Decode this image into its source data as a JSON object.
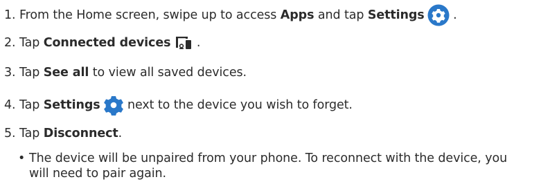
{
  "steps": [
    {
      "num": "1.",
      "pre": "From the Home screen, swipe up to access ",
      "bold1": "Apps",
      "mid": " and tap ",
      "bold2": "Settings",
      "post": " .",
      "icon": "settings-gear-circle-icon"
    },
    {
      "num": "2.",
      "pre": "Tap ",
      "bold": "Connected devices",
      "post": " .",
      "icon": "connected-devices-icon"
    },
    {
      "num": "3.",
      "pre": "Tap ",
      "bold": "See all",
      "post": " to view all saved devices."
    },
    {
      "num": "4.",
      "pre": "Tap ",
      "bold": "Settings",
      "post": " next to the device you wish to forget.",
      "icon": "settings-gear-icon"
    },
    {
      "num": "5.",
      "pre": "Tap ",
      "bold": "Disconnect",
      "post": "."
    }
  ],
  "bullet": {
    "marker": "•",
    "text": "The device will be unpaired from your phone. To reconnect with the device, you will need to pair again."
  },
  "colors": {
    "text": "#2b2b2b",
    "icon_blue": "#2a78c9",
    "icon_dark": "#2b2b2b"
  }
}
